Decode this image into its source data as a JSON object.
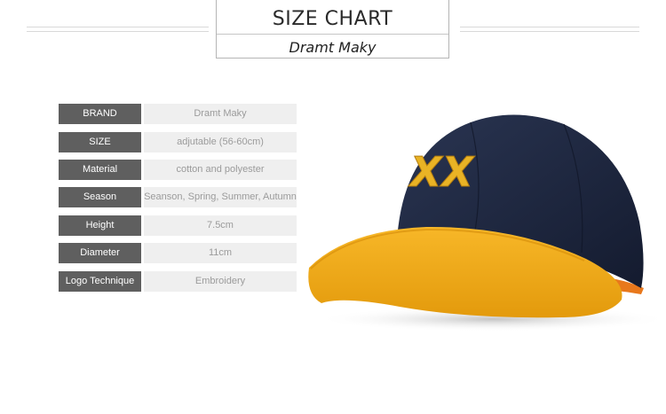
{
  "header": {
    "title": "SIZE CHART",
    "subtitle": "Dramt Maky"
  },
  "specs": [
    {
      "label": "BRAND",
      "value": "Dramt Maky"
    },
    {
      "label": "SIZE",
      "value": "adjutable (56-60cm)"
    },
    {
      "label": "Material",
      "value": "cotton and polyester"
    },
    {
      "label": "Season",
      "value": "Seanson, Spring, Summer, Autumn"
    },
    {
      "label": "Height",
      "value": "7.5cm"
    },
    {
      "label": "Diameter",
      "value": "11cm"
    },
    {
      "label": "Logo Technique",
      "value": "Embroidery"
    }
  ],
  "product": {
    "logo_text": "XX",
    "crown_color": "#1e2740",
    "brim_color": "#f2ae1a",
    "logo_color": "#e9b325"
  }
}
